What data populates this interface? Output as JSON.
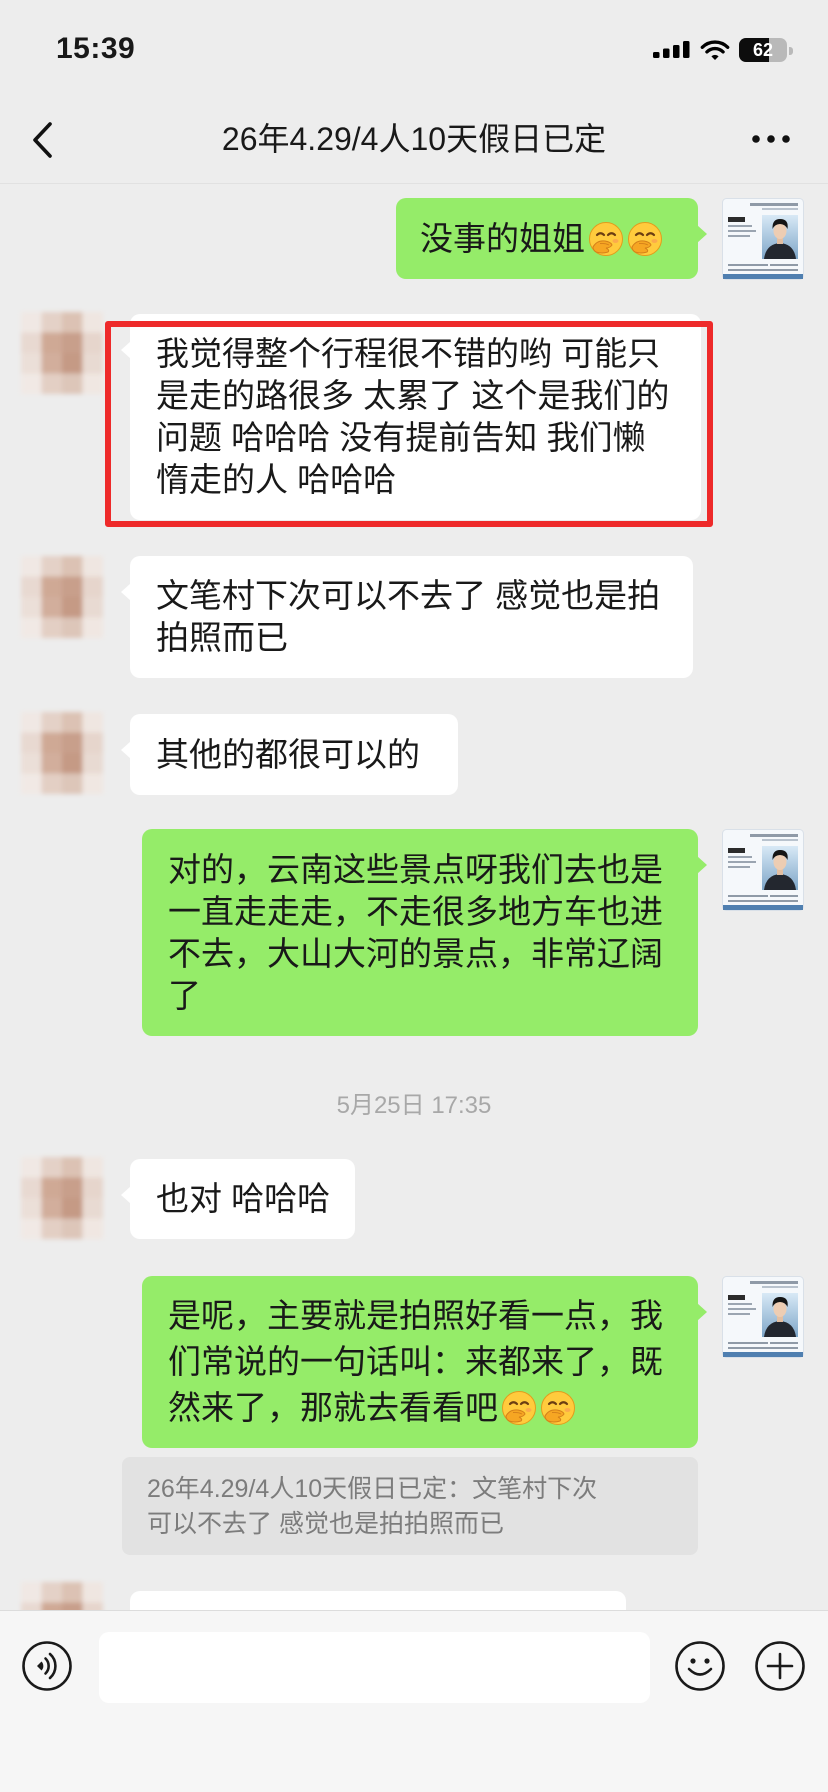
{
  "status_bar": {
    "time": "15:39",
    "battery_percent": 62,
    "icons": [
      "cellular-signal-icon",
      "wifi-icon",
      "battery-icon"
    ]
  },
  "nav": {
    "back_icon": "chevron-left-icon",
    "title": "26年4.29/4人10天假日已定",
    "more_icon": "more-dots-icon"
  },
  "colors": {
    "chat_background": "#ededed",
    "outgoing_bubble": "#95ec69",
    "incoming_bubble": "#ffffff",
    "highlight_border": "#ee2a2a",
    "timestamp_text": "#a8a8a8",
    "quote_background": "#e2e2e2"
  },
  "chat": {
    "messages": [
      {
        "side": "right",
        "avatar": "business-card-avatar-image",
        "lines": [
          "没事的姐姐"
        ],
        "trailing_emoji": [
          "hand-over-mouth-emoji",
          "hand-over-mouth-emoji"
        ]
      },
      {
        "side": "left",
        "avatar": "blurred-avatar-image",
        "highlighted": true,
        "lines": [
          "我觉得整个行程很不错的哟 可能只",
          "是走的路很多 太累了 这个是我们的",
          "问题 哈哈哈 没有提前告知 我们懒",
          "惰走的人 哈哈哈"
        ]
      },
      {
        "side": "left",
        "avatar": "blurred-avatar-image",
        "lines": [
          "文笔村下次可以不去了 感觉也是拍",
          "拍照而已"
        ]
      },
      {
        "side": "left",
        "avatar": "blurred-avatar-image",
        "lines": [
          "其他的都很可以的"
        ]
      },
      {
        "side": "right",
        "avatar": "business-card-avatar-image",
        "lines": [
          "对的，云南这些景点呀我们去也是",
          "一直走走走，不走很多地方车也进",
          "不去，大山大河的景点，非常辽阔",
          "了"
        ]
      },
      {
        "type": "timestamp",
        "text": "5月25日 17:35"
      },
      {
        "side": "left",
        "avatar": "blurred-avatar-image",
        "lines": [
          "也对 哈哈哈"
        ]
      },
      {
        "side": "right",
        "avatar": "business-card-avatar-image",
        "lines": [
          "是呢，主要就是拍照好看一点，我",
          "们常说的一句话叫：来都来了，既",
          "然来了，那就去看看吧"
        ],
        "trailing_emoji": [
          "hand-over-mouth-emoji",
          "hand-over-mouth-emoji"
        ],
        "quote": {
          "lines": [
            "26年4.29/4人10天假日已定：文笔村下次",
            "可以不去了 感觉也是拍拍照而已"
          ]
        }
      },
      {
        "side": "left",
        "avatar": "blurred-avatar-image",
        "lines": [],
        "partially_visible": true
      }
    ]
  },
  "input_bar": {
    "left_icon": "voice-input-icon",
    "right_icons": [
      "emoji-icon",
      "plus-icon"
    ]
  }
}
